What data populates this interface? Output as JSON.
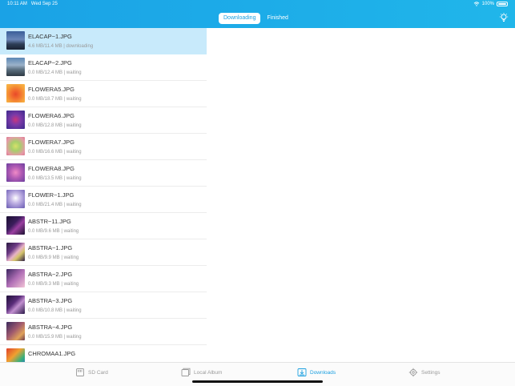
{
  "status_bar": {
    "time": "10:11 AM",
    "date": "Wed Sep 25",
    "battery": "100%"
  },
  "header": {
    "segments": [
      {
        "label": "Downloading",
        "active": true
      },
      {
        "label": "Finished",
        "active": false
      }
    ]
  },
  "downloads": [
    {
      "name": "ELACAP~1.JPG",
      "status": "4.6 MB/11.4 MB | downloading"
    },
    {
      "name": "ELACAP~2.JPG",
      "status": "0.0 MB/12.4 MB | waiting"
    },
    {
      "name": "FLOWERA5.JPG",
      "status": "0.0 MB/18.7 MB | waiting"
    },
    {
      "name": "FLOWERA6.JPG",
      "status": "0.0 MB/12.8 MB | waiting"
    },
    {
      "name": "FLOWERA7.JPG",
      "status": "0.0 MB/16.6 MB | waiting"
    },
    {
      "name": "FLOWERA8.JPG",
      "status": "0.0 MB/13.5 MB | waiting"
    },
    {
      "name": "FLOWER~1.JPG",
      "status": "0.0 MB/21.4 MB | waiting"
    },
    {
      "name": "ABSTR~11.JPG",
      "status": "0.0 MB/9.6 MB | waiting"
    },
    {
      "name": "ABSTRA~1.JPG",
      "status": "0.0 MB/9.9 MB | waiting"
    },
    {
      "name": "ABSTRA~2.JPG",
      "status": "0.0 MB/9.3 MB | waiting"
    },
    {
      "name": "ABSTRA~3.JPG",
      "status": "0.0 MB/10.8 MB | waiting"
    },
    {
      "name": "ABSTRA~4.JPG",
      "status": "0.0 MB/15.9 MB | waiting"
    },
    {
      "name": "CHROMAA1.JPG",
      "status": ""
    }
  ],
  "tabbar": {
    "tabs": [
      {
        "label": "SD Card",
        "active": false
      },
      {
        "label": "Local Album",
        "active": false
      },
      {
        "label": "Downloads",
        "active": true
      },
      {
        "label": "Settings",
        "active": false
      }
    ]
  },
  "colors": {
    "accent": "#1a9fe0",
    "header": "#1fb0ea",
    "selected_row": "#c8eafb"
  },
  "icons": [
    "wifi-icon",
    "battery-icon",
    "lightbulb-icon",
    "sd-card-icon",
    "album-icon",
    "downloads-icon",
    "settings-icon"
  ]
}
